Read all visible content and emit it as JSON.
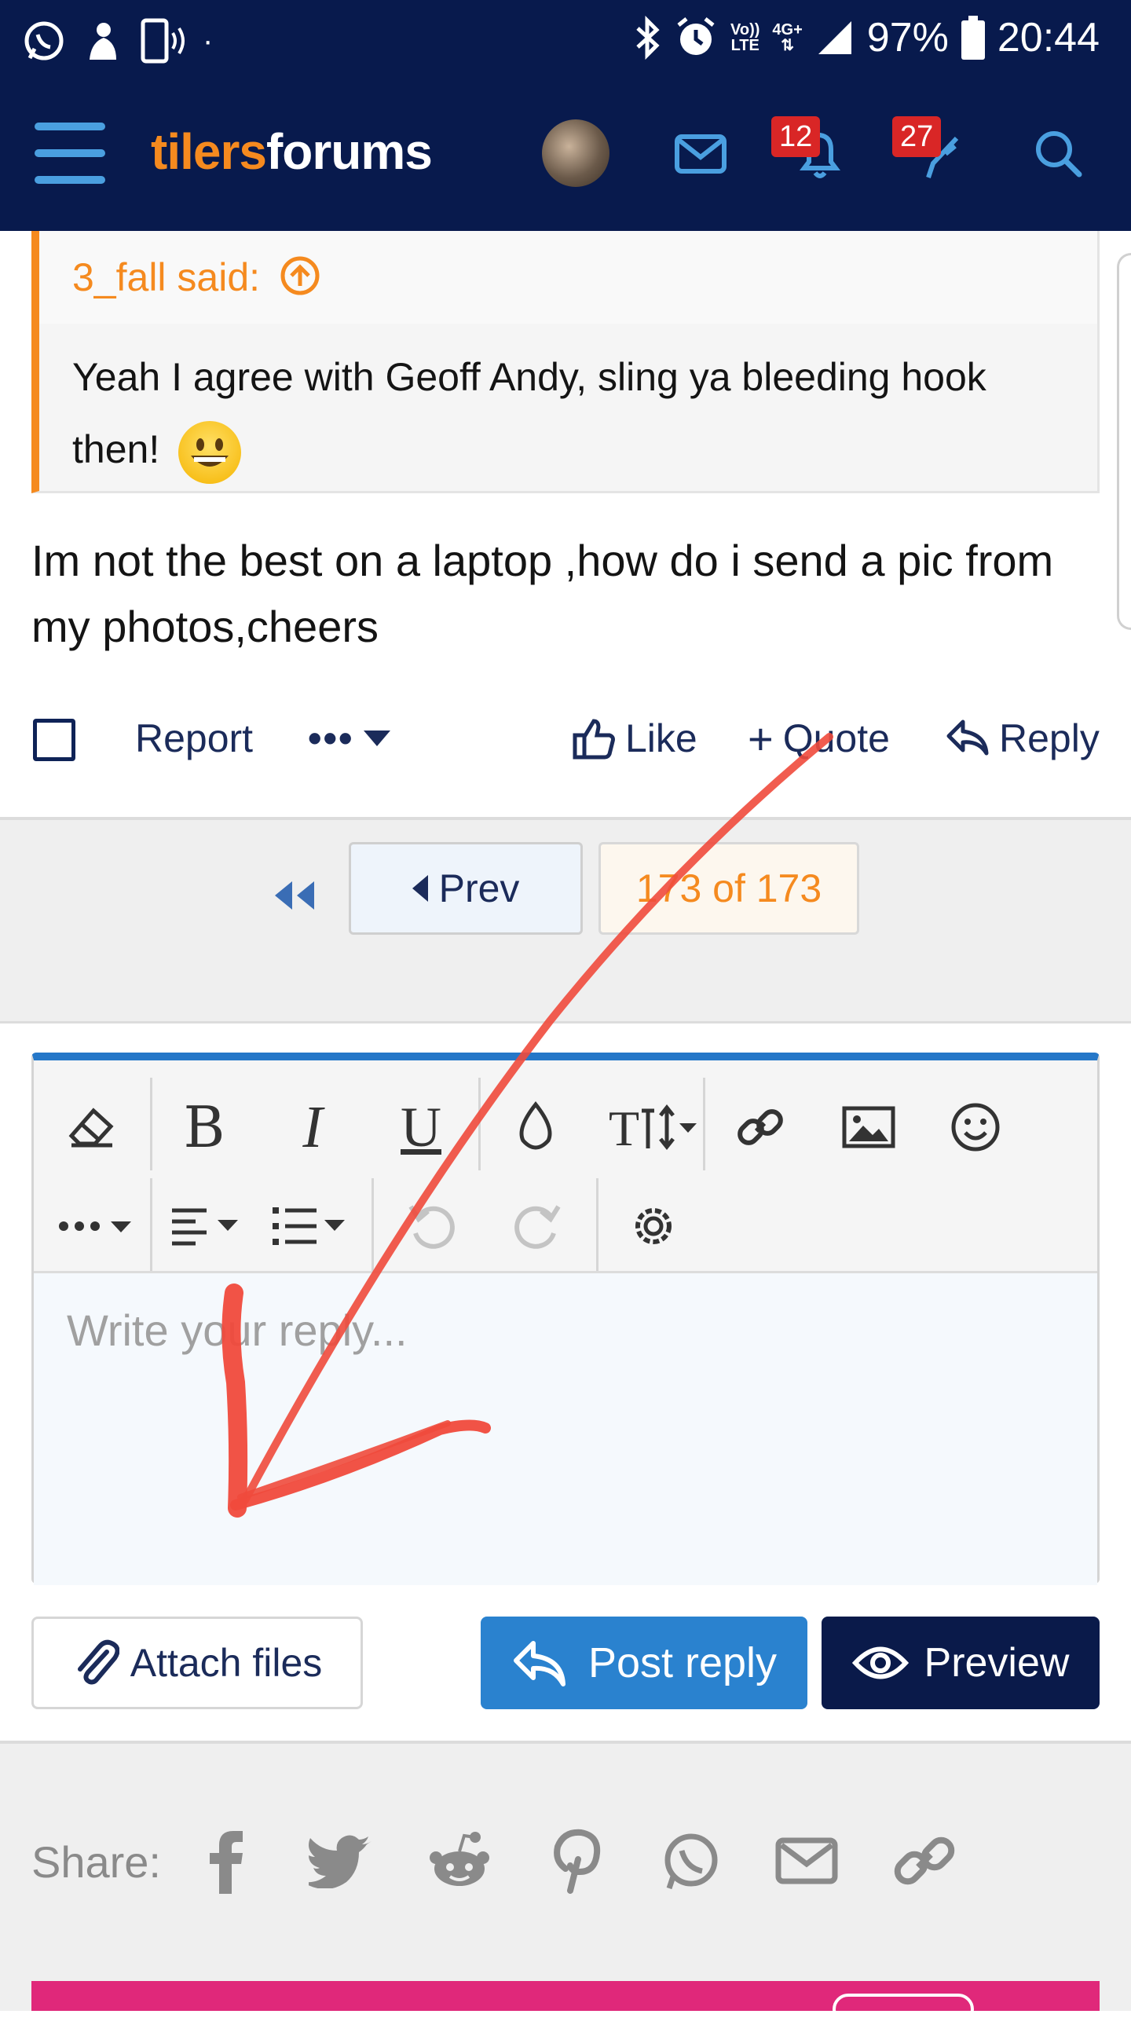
{
  "status_bar": {
    "battery_percent": "97%",
    "time": "20:44",
    "network_top": "Vo))",
    "network_bottom": "LTE",
    "network_gen": "4G+"
  },
  "nav": {
    "logo_part1": "tilers",
    "logo_part2": "forums",
    "alerts_badge": "12",
    "conversations_badge": "27"
  },
  "quote": {
    "author": "3_fall said:",
    "text": "Yeah I agree with Geoff Andy, sling ya bleeding hook then!"
  },
  "post": {
    "text": "Im not the best on a laptop ,how do i send a pic from my photos,cheers"
  },
  "actions": {
    "report": "Report",
    "more": "•••",
    "like": "Like",
    "quote": "Quote",
    "reply": "Reply"
  },
  "pagination": {
    "prev": "Prev",
    "page_info": "173 of 173"
  },
  "editor": {
    "placeholder": "Write your reply...",
    "value": ""
  },
  "buttons": {
    "attach": "Attach files",
    "post_reply": "Post reply",
    "preview": "Preview"
  },
  "share": {
    "label": "Share:"
  },
  "colors": {
    "navy": "#081a4d",
    "orange": "#f58a1f",
    "blue": "#2a82cf",
    "badge_red": "#d92626",
    "annotation_red": "#f04a3c"
  }
}
